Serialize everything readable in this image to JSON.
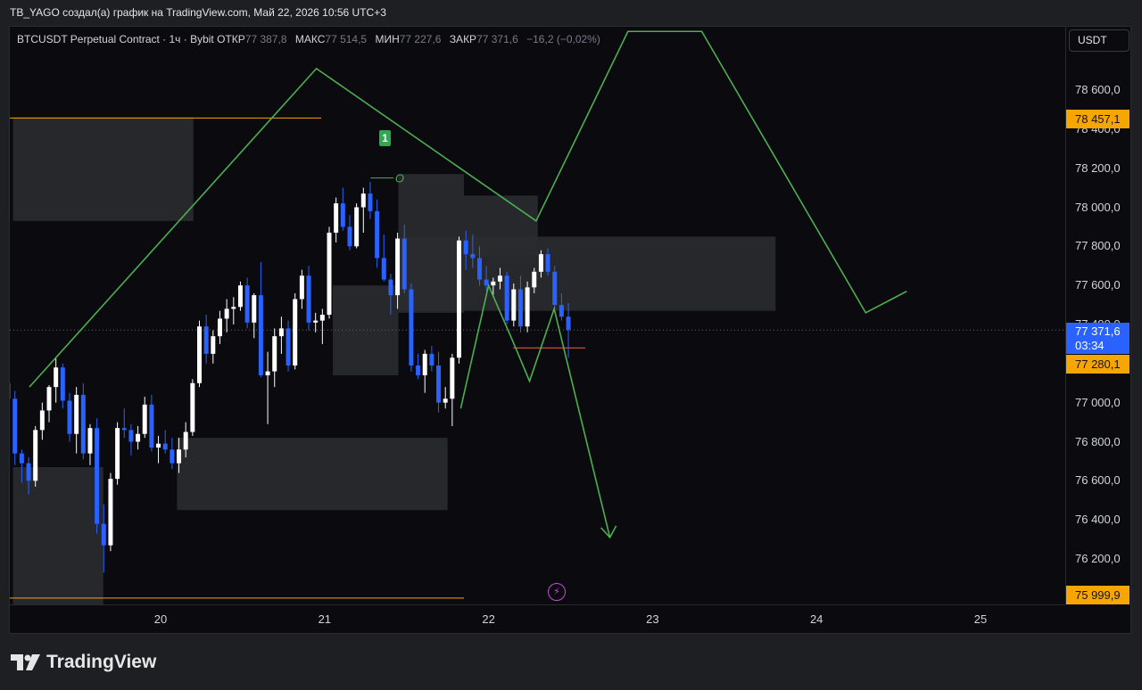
{
  "caption": "TB_YAGO создал(а) график на TradingView.com, Май 22, 2026 10:56 UTC+3",
  "legend": {
    "symbol": "BTCUSDT Perpetual Contract · 1ч · Bybit",
    "open_label": "ОТКР",
    "open_value": "77 387,8",
    "high_label": "МАКС",
    "high_value": "77 514,5",
    "low_label": "МИН",
    "low_value": "77 227,6",
    "close_label": "ЗАКР",
    "close_value": "77 371,6",
    "change": "−16,2 (−0,02%)"
  },
  "currency_button": "USDT",
  "logo_text": "TradingView",
  "marker_label": "1",
  "marker_o": "O",
  "tags": {
    "level_high": "78 457,1",
    "last_price": "77 371,6",
    "countdown": "03:34",
    "level_mid": "77 280,1",
    "level_low": "75 999,9"
  },
  "colors": {
    "background": "#0b0b0f",
    "up_candle": "#ffffff",
    "down_candle": "#2962ff",
    "zone": "#2a2b30",
    "projection": "#4caf50",
    "level_line": "#f7a600",
    "last_price": "#2962ff"
  },
  "chart_data": {
    "type": "candlestick",
    "symbol": "BTCUSDT",
    "timeframe": "1ч",
    "ylim": [
      76000,
      78700
    ],
    "y_ticks": [
      "78 600,0",
      "78 400,0",
      "78 200,0",
      "78 000,0",
      "77 800,0",
      "77 600,0",
      "77 400,0",
      "77 000,0",
      "76 800,0",
      "76 600,0",
      "76 400,0",
      "76 200,0"
    ],
    "x_ticks": [
      "20",
      "21",
      "22",
      "23",
      "24",
      "25"
    ],
    "levels": [
      78457.1,
      77280.1,
      75999.9
    ],
    "last_price": 77371.6,
    "zones": [
      {
        "x0": 19.1,
        "x1": 20.2,
        "y0": 77930,
        "y1": 78460
      },
      {
        "x0": 19.1,
        "x1": 19.65,
        "y0": 75780,
        "y1": 76670
      },
      {
        "x0": 20.1,
        "x1": 21.75,
        "y0": 76450,
        "y1": 76820
      },
      {
        "x0": 21.05,
        "x1": 21.45,
        "y0": 77140,
        "y1": 77600
      },
      {
        "x0": 21.45,
        "x1": 21.85,
        "y0": 77460,
        "y1": 78170
      },
      {
        "x0": 21.85,
        "x1": 22.3,
        "y0": 77750,
        "y1": 78060
      },
      {
        "x0": 21.45,
        "x1": 23.75,
        "y0": 77470,
        "y1": 77850
      }
    ],
    "projection_path": [
      [
        19.2,
        77080
      ],
      [
        20.95,
        78710
      ],
      [
        22.29,
        77930
      ],
      [
        22.85,
        78900
      ],
      [
        23.3,
        78900
      ],
      [
        24.3,
        77460
      ],
      [
        24.55,
        77570
      ]
    ],
    "projection_path_2": [
      [
        21.83,
        76970
      ],
      [
        22.0,
        77600
      ],
      [
        22.15,
        77310
      ],
      [
        22.25,
        77110
      ],
      [
        22.4,
        77480
      ],
      [
        22.74,
        76310
      ]
    ],
    "candles": [
      [
        77100,
        77130,
        76990,
        77020
      ],
      [
        77020,
        77060,
        76680,
        76740
      ],
      [
        76740,
        76760,
        76590,
        76690
      ],
      [
        76690,
        76720,
        76530,
        76600
      ],
      [
        76600,
        76880,
        76570,
        76860
      ],
      [
        76860,
        77000,
        76810,
        76960
      ],
      [
        76960,
        77090,
        76900,
        77080
      ],
      [
        77080,
        77230,
        77000,
        77180
      ],
      [
        77180,
        77200,
        76970,
        77010
      ],
      [
        77010,
        77050,
        76800,
        76840
      ],
      [
        76840,
        77080,
        76740,
        77040
      ],
      [
        77040,
        77100,
        76710,
        76740
      ],
      [
        76740,
        76890,
        76680,
        76870
      ],
      [
        76870,
        76920,
        76330,
        76380
      ],
      [
        76380,
        76480,
        76130,
        76270
      ],
      [
        76270,
        76640,
        76240,
        76610
      ],
      [
        76610,
        76900,
        76580,
        76870
      ],
      [
        76870,
        76970,
        76820,
        76860
      ],
      [
        76860,
        76890,
        76730,
        76800
      ],
      [
        76800,
        76880,
        76760,
        76840
      ],
      [
        76840,
        77030,
        76820,
        76990
      ],
      [
        76990,
        77040,
        76750,
        76770
      ],
      [
        76770,
        76830,
        76690,
        76790
      ],
      [
        76790,
        76860,
        76740,
        76760
      ],
      [
        76760,
        76820,
        76660,
        76690
      ],
      [
        76690,
        76820,
        76640,
        76760
      ],
      [
        76760,
        76900,
        76720,
        76850
      ],
      [
        76850,
        77120,
        76830,
        77100
      ],
      [
        77100,
        77420,
        77080,
        77390
      ],
      [
        77390,
        77450,
        77200,
        77250
      ],
      [
        77250,
        77370,
        77200,
        77340
      ],
      [
        77340,
        77470,
        77300,
        77430
      ],
      [
        77430,
        77530,
        77360,
        77480
      ],
      [
        77480,
        77540,
        77400,
        77490
      ],
      [
        77490,
        77620,
        77470,
        77600
      ],
      [
        77600,
        77640,
        77380,
        77410
      ],
      [
        77410,
        77560,
        77330,
        77550
      ],
      [
        77550,
        77720,
        77130,
        77140
      ],
      [
        77140,
        77260,
        76890,
        77160
      ],
      [
        77160,
        77380,
        77080,
        77340
      ],
      [
        77340,
        77440,
        77250,
        77380
      ],
      [
        77380,
        77420,
        77160,
        77190
      ],
      [
        77190,
        77560,
        77170,
        77530
      ],
      [
        77530,
        77680,
        77480,
        77650
      ],
      [
        77650,
        77700,
        77370,
        77410
      ],
      [
        77410,
        77460,
        77360,
        77420
      ],
      [
        77420,
        77480,
        77300,
        77450
      ],
      [
        77450,
        77900,
        77430,
        77870
      ],
      [
        77870,
        78050,
        77820,
        78020
      ],
      [
        78020,
        78100,
        77880,
        77900
      ],
      [
        77900,
        77960,
        77780,
        77800
      ],
      [
        77800,
        78020,
        77790,
        78000
      ],
      [
        78000,
        78100,
        77870,
        78070
      ],
      [
        78070,
        78130,
        77940,
        77980
      ],
      [
        77980,
        78040,
        77690,
        77740
      ],
      [
        77740,
        77860,
        77620,
        77630
      ],
      [
        77630,
        77660,
        77450,
        77550
      ],
      [
        77550,
        77870,
        77480,
        77840
      ],
      [
        77840,
        77910,
        77560,
        77580
      ],
      [
        77580,
        77610,
        77160,
        77190
      ],
      [
        77190,
        77250,
        77120,
        77140
      ],
      [
        77140,
        77270,
        77050,
        77250
      ],
      [
        77250,
        77290,
        77160,
        77190
      ],
      [
        77190,
        77260,
        76950,
        77000
      ],
      [
        77000,
        77080,
        76970,
        77020
      ],
      [
        77020,
        77250,
        76880,
        77230
      ],
      [
        77230,
        77850,
        77200,
        77830
      ],
      [
        77830,
        77880,
        77680,
        77760
      ],
      [
        77760,
        77860,
        77690,
        77740
      ],
      [
        77740,
        77800,
        77600,
        77630
      ],
      [
        77630,
        77700,
        77570,
        77600
      ],
      [
        77600,
        77640,
        77540,
        77620
      ],
      [
        77620,
        77690,
        77580,
        77650
      ],
      [
        77650,
        77670,
        77400,
        77420
      ],
      [
        77420,
        77610,
        77390,
        77580
      ],
      [
        77580,
        77650,
        77360,
        77390
      ],
      [
        77390,
        77620,
        77360,
        77590
      ],
      [
        77590,
        77690,
        77560,
        77670
      ],
      [
        77670,
        77780,
        77640,
        77760
      ],
      [
        77760,
        77790,
        77650,
        77670
      ],
      [
        77670,
        77700,
        77480,
        77500
      ],
      [
        77500,
        77560,
        77420,
        77440
      ],
      [
        77440,
        77510,
        77230,
        77371.6
      ]
    ]
  }
}
